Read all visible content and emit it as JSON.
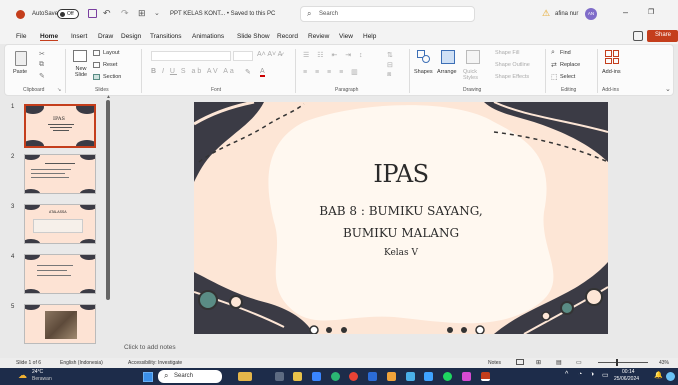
{
  "titlebar": {
    "autosave_label": "AutoSave",
    "autosave_state": "Off",
    "file_title": "PPT KELAS KONT... • Saved to this PC",
    "search_placeholder": "Search",
    "user_name": "afina nur",
    "user_initials": "AN"
  },
  "menu": {
    "items": [
      "File",
      "Home",
      "Insert",
      "Draw",
      "Design",
      "Transitions",
      "Animations",
      "Slide Show",
      "Record",
      "Review",
      "View",
      "Help"
    ],
    "share_label": "Share"
  },
  "ribbon": {
    "clipboard": {
      "paste": "Paste",
      "group": "Clipboard"
    },
    "slides": {
      "new_slide": "New Slide",
      "layout": "Layout",
      "reset": "Reset",
      "section": "Section",
      "group": "Slides"
    },
    "font": {
      "group": "Font"
    },
    "paragraph": {
      "group": "Paragraph"
    },
    "drawing": {
      "shapes": "Shapes",
      "arrange": "Arrange",
      "quick_styles": "Quick Styles",
      "shape_fill": "Shape Fill",
      "shape_outline": "Shape Outline",
      "shape_effects": "Shape Effects",
      "group": "Drawing"
    },
    "editing": {
      "find": "Find",
      "replace": "Replace",
      "select": "Select",
      "group": "Editing"
    },
    "addins": {
      "label": "Add-ins",
      "group": "Add-ins"
    }
  },
  "thumbnails": {
    "numbers": [
      "1",
      "2",
      "3",
      "4",
      "5"
    ],
    "t1_title": "IPAS",
    "t3_title": "ATALASSA"
  },
  "slide": {
    "title": "IPAS",
    "subtitle_line1": "BAB 8 : BUMIKU SAYANG,",
    "subtitle_line2": "BUMIKU MALANG",
    "class_label": "Kelas V"
  },
  "notes": {
    "placeholder": "Click to add notes"
  },
  "status": {
    "slide_info": "Slide 1 of 6",
    "language": "English (Indonesia)",
    "accessibility": "Accessibility: Investigate",
    "notes_label": "Notes",
    "zoom": "43%"
  },
  "taskbar": {
    "temperature": "24°C",
    "weather": "Berawan",
    "search_label": "Search",
    "time": "00:14",
    "date": "25/06/2024"
  },
  "colors": {
    "accent": "#c43e1c",
    "slide_bg": "#fde6d6",
    "dark_wave": "#3b3b45",
    "teal": "#5a8c84"
  }
}
